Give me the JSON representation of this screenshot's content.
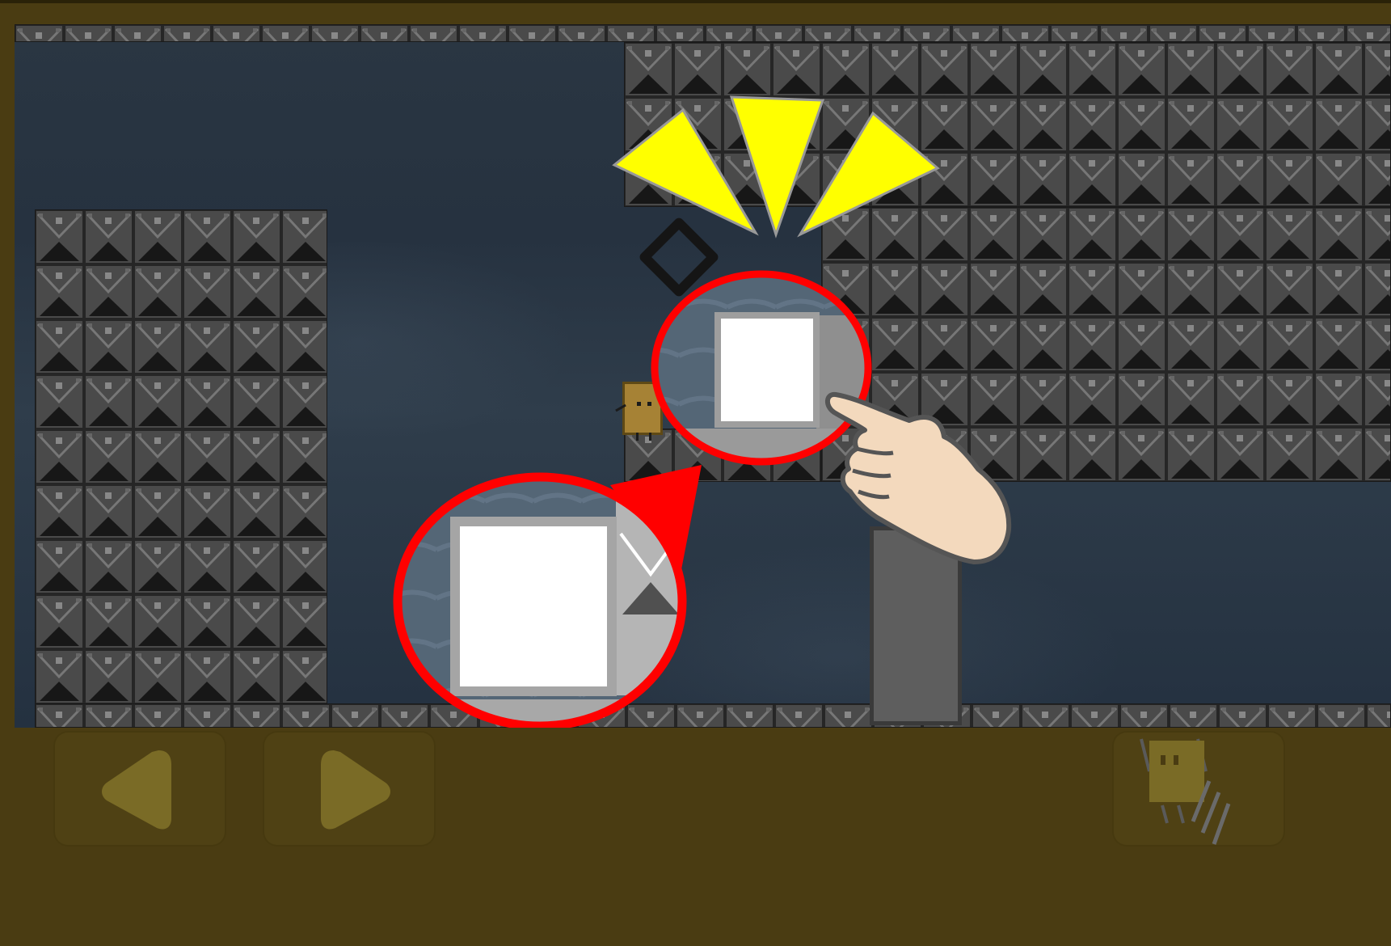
{
  "colors": {
    "frame": "#4a3c12",
    "highlight": "#ff0000",
    "flash": "#ffff00",
    "tile": "#4a4a4a",
    "player": "#a68235",
    "button_icon": "#7a6b26"
  },
  "game": {
    "scene": "tile-platformer-level",
    "highlighted_object": "white-block",
    "gesture": "tap",
    "controls": [
      {
        "name": "move-left",
        "icon": "left-triangle-icon"
      },
      {
        "name": "move-right",
        "icon": "right-triangle-icon"
      },
      {
        "name": "dash",
        "icon": "dashing-player-icon"
      }
    ]
  }
}
